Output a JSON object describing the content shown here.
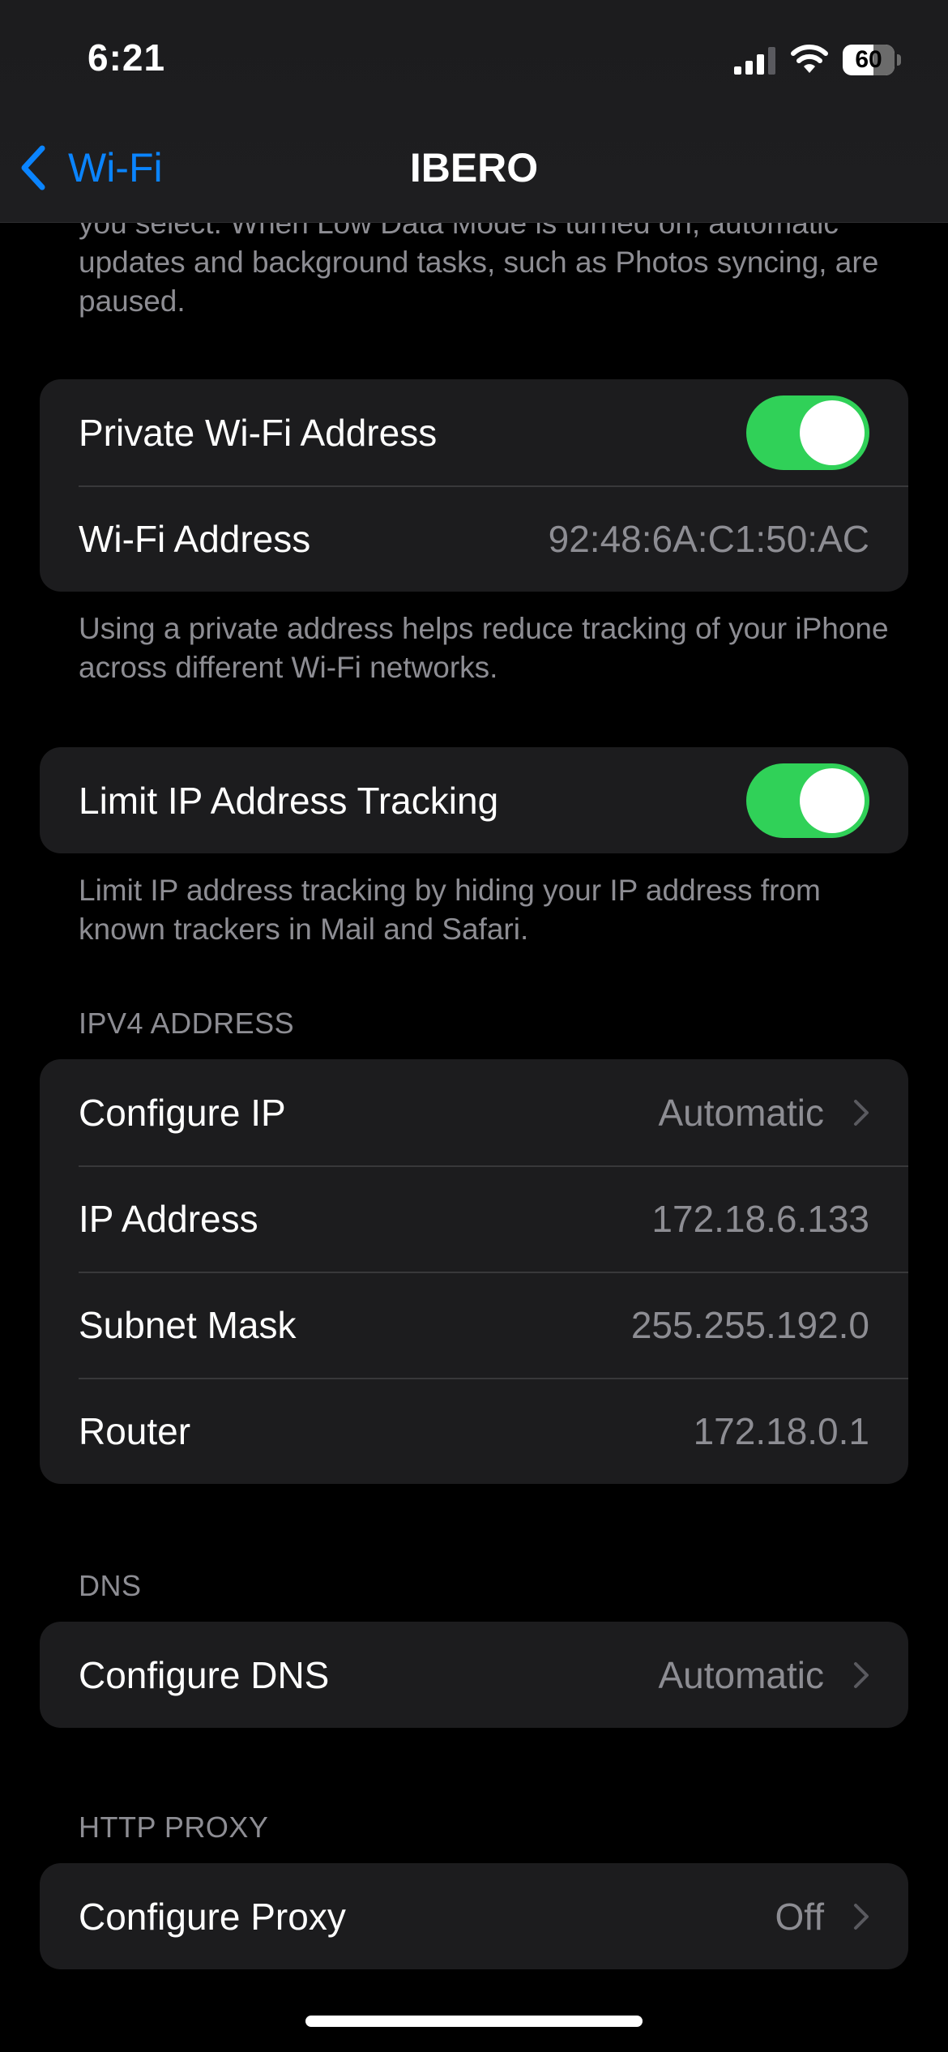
{
  "status_bar": {
    "time": "6:21",
    "battery_level": "60",
    "battery_fraction": 0.6
  },
  "nav": {
    "back_label": "Wi-Fi",
    "title": "IBERO"
  },
  "low_data_footer": "you select. When Low Data Mode is turned on, automatic updates and background tasks, such as Photos syncing, are paused.",
  "private_address": {
    "toggle_label": "Private Wi-Fi Address",
    "toggle_on": true,
    "address_label": "Wi-Fi Address",
    "address_value": "92:48:6A:C1:50:AC",
    "footer": "Using a private address helps reduce tracking of your iPhone across different Wi-Fi networks."
  },
  "limit_tracking": {
    "toggle_label": "Limit IP Address Tracking",
    "toggle_on": true,
    "footer": "Limit IP address tracking by hiding your IP address from known trackers in Mail and Safari."
  },
  "ipv4": {
    "header": "IPV4 ADDRESS",
    "rows": [
      {
        "label": "Configure IP",
        "value": "Automatic"
      },
      {
        "label": "IP Address",
        "value": "172.18.6.133"
      },
      {
        "label": "Subnet Mask",
        "value": "255.255.192.0"
      },
      {
        "label": "Router",
        "value": "172.18.0.1"
      }
    ]
  },
  "dns": {
    "header": "DNS",
    "label": "Configure DNS",
    "value": "Automatic"
  },
  "proxy": {
    "header": "HTTP PROXY",
    "label": "Configure Proxy",
    "value": "Off"
  },
  "colors": {
    "accent": "#0a84ff",
    "toggle_on": "#30d158",
    "cell_background": "#1c1c1e",
    "secondary_text": "#8d8d93"
  },
  "icons": [
    "back-chevron-icon",
    "signal-icon",
    "wifi-icon",
    "battery-icon",
    "chevron-right-icon"
  ]
}
